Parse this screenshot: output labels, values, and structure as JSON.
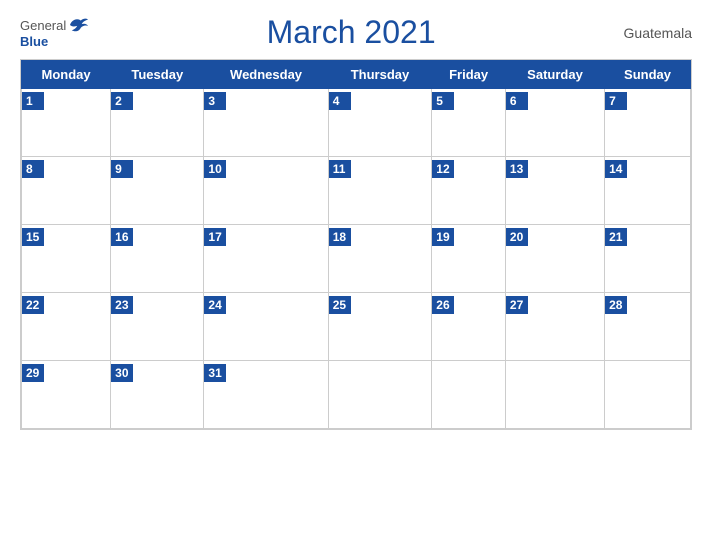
{
  "header": {
    "logo_general": "General",
    "logo_blue": "Blue",
    "title": "March 2021",
    "country": "Guatemala"
  },
  "days": [
    "Monday",
    "Tuesday",
    "Wednesday",
    "Thursday",
    "Friday",
    "Saturday",
    "Sunday"
  ],
  "weeks": [
    {
      "label_bg": true,
      "cells": [
        {
          "date": "1",
          "empty": false
        },
        {
          "date": "2",
          "empty": false
        },
        {
          "date": "3",
          "empty": false
        },
        {
          "date": "4",
          "empty": false
        },
        {
          "date": "5",
          "empty": false
        },
        {
          "date": "6",
          "empty": false
        },
        {
          "date": "7",
          "empty": false
        }
      ]
    },
    {
      "label_bg": true,
      "cells": [
        {
          "date": "8",
          "empty": false
        },
        {
          "date": "9",
          "empty": false
        },
        {
          "date": "10",
          "empty": false
        },
        {
          "date": "11",
          "empty": false
        },
        {
          "date": "12",
          "empty": false
        },
        {
          "date": "13",
          "empty": false
        },
        {
          "date": "14",
          "empty": false
        }
      ]
    },
    {
      "label_bg": true,
      "cells": [
        {
          "date": "15",
          "empty": false
        },
        {
          "date": "16",
          "empty": false
        },
        {
          "date": "17",
          "empty": false
        },
        {
          "date": "18",
          "empty": false
        },
        {
          "date": "19",
          "empty": false
        },
        {
          "date": "20",
          "empty": false
        },
        {
          "date": "21",
          "empty": false
        }
      ]
    },
    {
      "label_bg": true,
      "cells": [
        {
          "date": "22",
          "empty": false
        },
        {
          "date": "23",
          "empty": false
        },
        {
          "date": "24",
          "empty": false
        },
        {
          "date": "25",
          "empty": false
        },
        {
          "date": "26",
          "empty": false
        },
        {
          "date": "27",
          "empty": false
        },
        {
          "date": "28",
          "empty": false
        }
      ]
    },
    {
      "label_bg": true,
      "cells": [
        {
          "date": "29",
          "empty": false
        },
        {
          "date": "30",
          "empty": false
        },
        {
          "date": "31",
          "empty": false
        },
        {
          "date": "",
          "empty": true
        },
        {
          "date": "",
          "empty": true
        },
        {
          "date": "",
          "empty": true
        },
        {
          "date": "",
          "empty": true
        }
      ]
    }
  ],
  "colors": {
    "header_bg": "#1a4fa0",
    "header_text": "#ffffff",
    "cell_bg": "#ffffff",
    "border": "#cccccc",
    "title_color": "#1a4fa0"
  }
}
